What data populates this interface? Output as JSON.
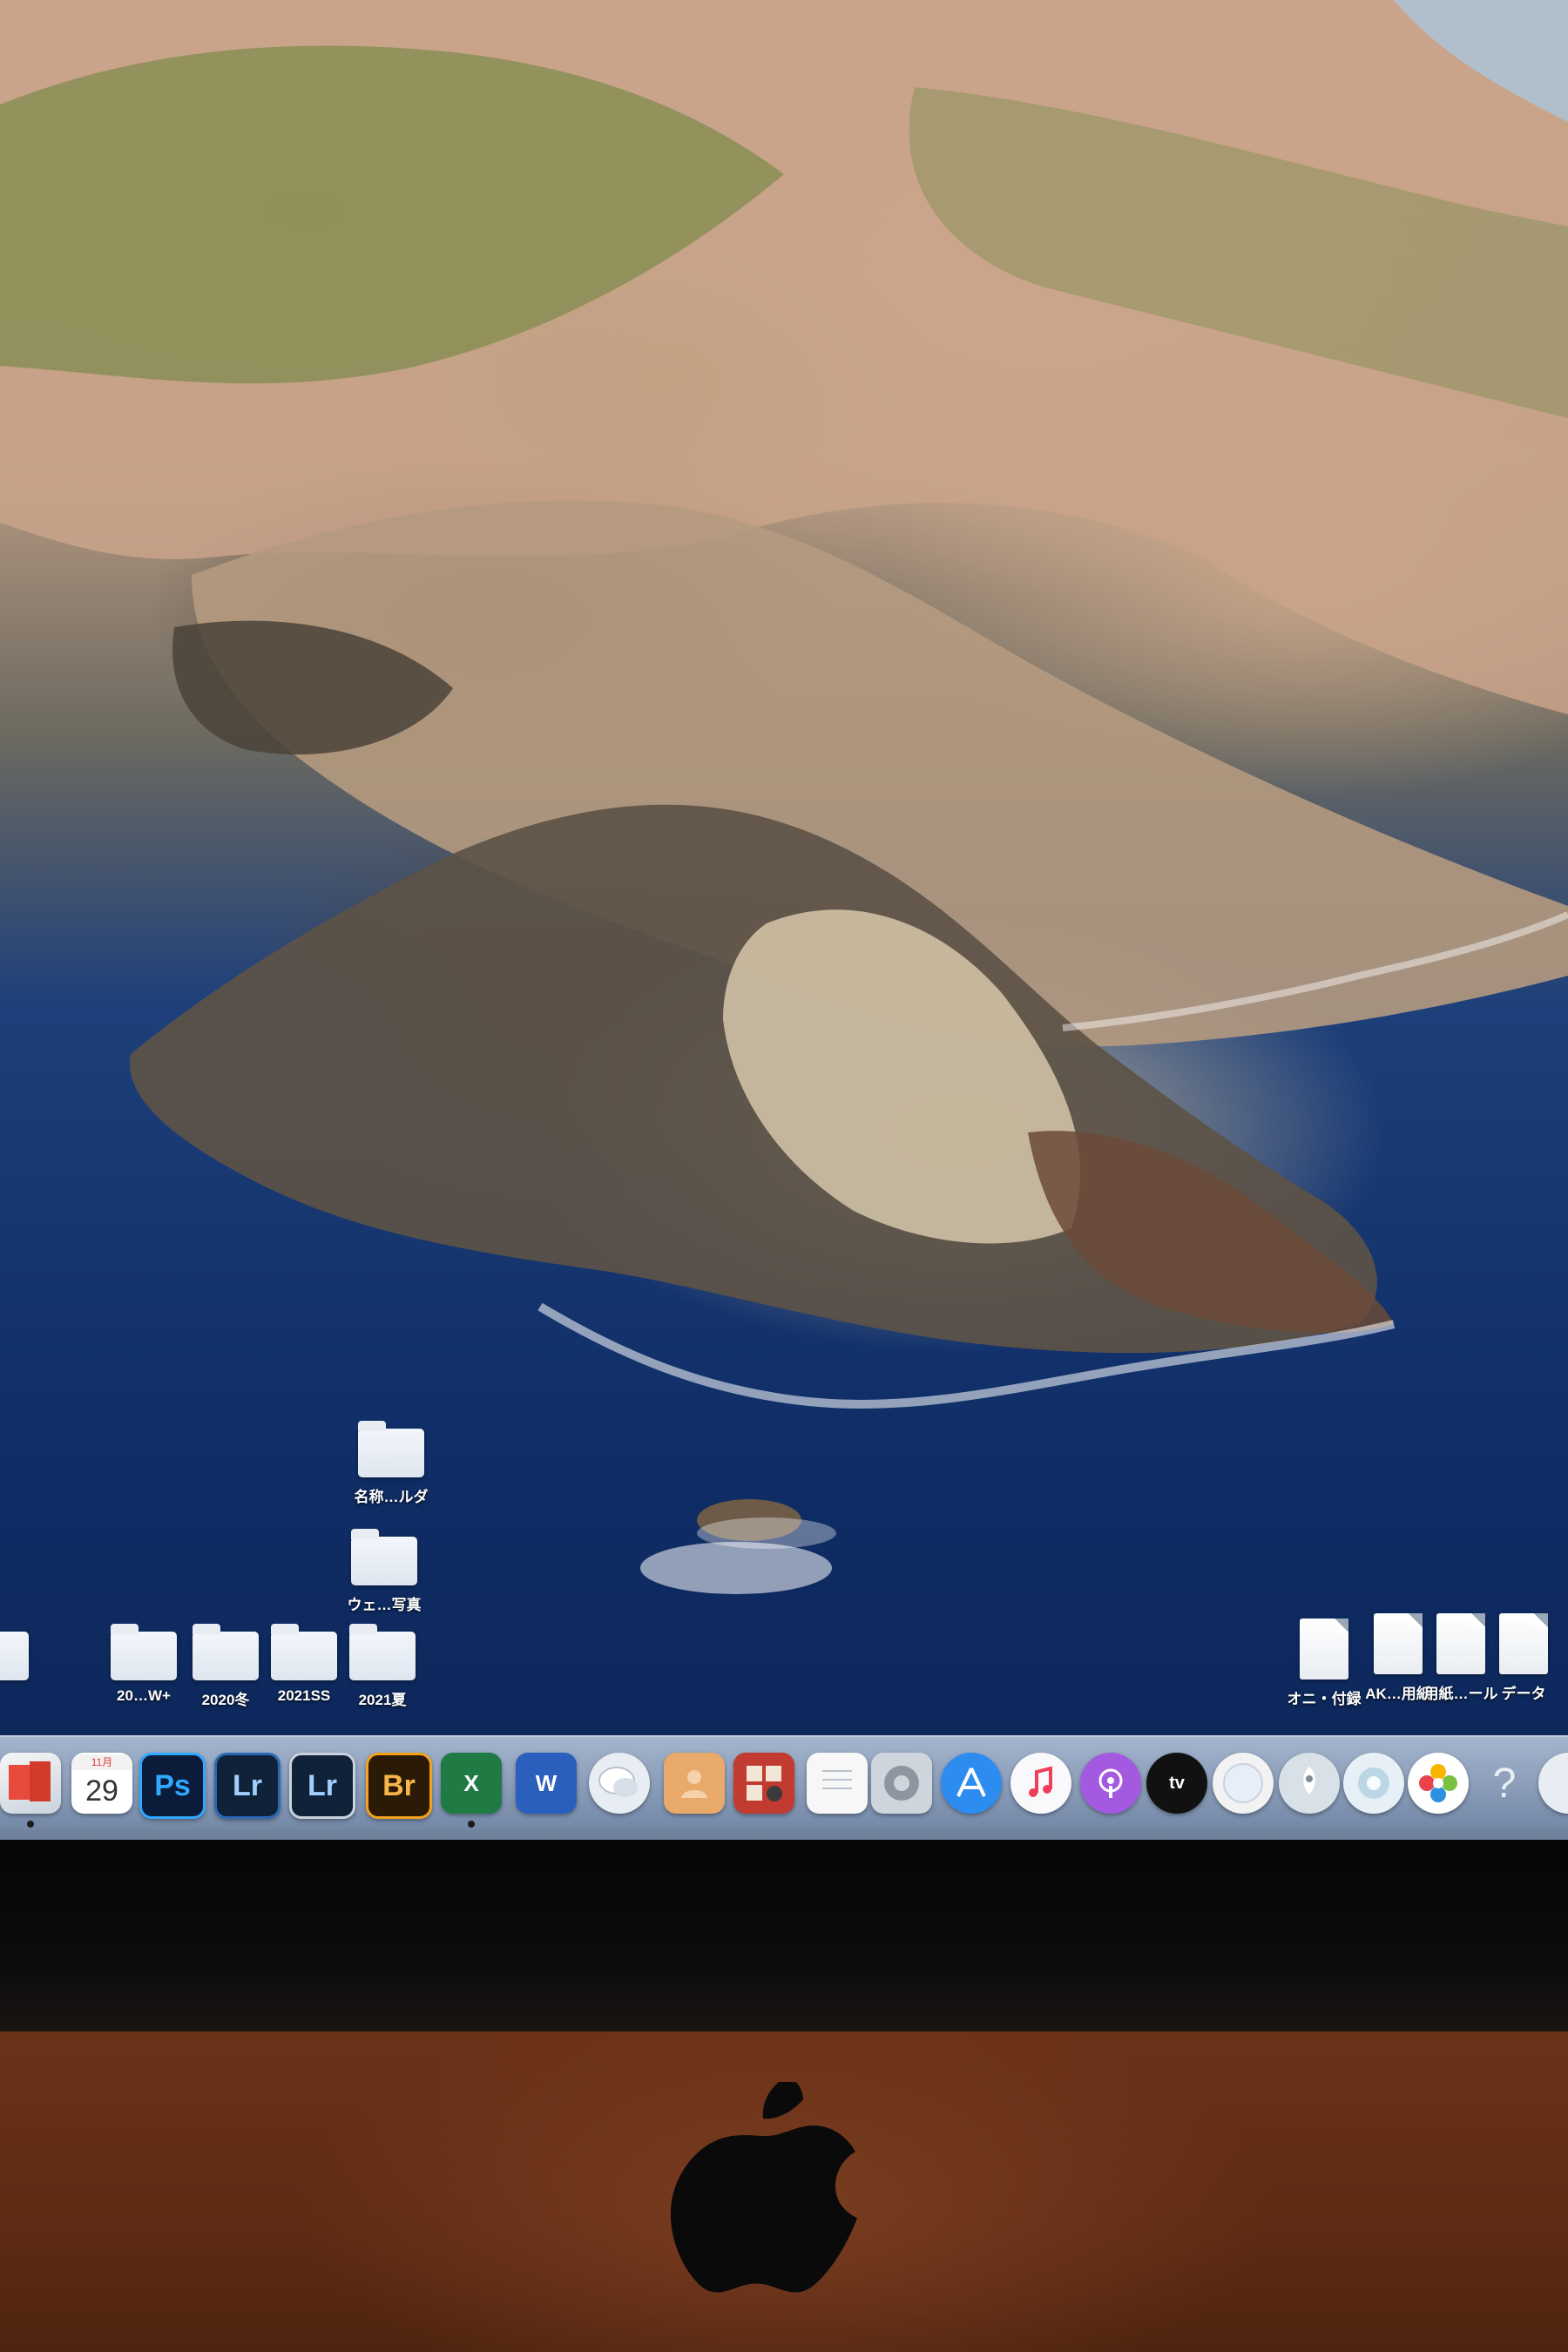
{
  "desktop": {
    "folders": [
      {
        "label": "名称…ルダ"
      },
      {
        "label": "ウェ…写真"
      },
      {
        "label": "20…W+"
      },
      {
        "label": "2020冬"
      },
      {
        "label": "2021SS"
      },
      {
        "label": "2021夏"
      }
    ],
    "files": [
      {
        "label": "オニ・付録"
      },
      {
        "label": "AK…用紙"
      },
      {
        "label": "用紙…ール"
      },
      {
        "label": "データ"
      }
    ]
  },
  "dock": {
    "items": [
      {
        "name": "preview",
        "label": ""
      },
      {
        "name": "calendar",
        "label": "29",
        "month": "11月"
      },
      {
        "name": "photoshop",
        "label": "Ps"
      },
      {
        "name": "lightroom",
        "label": "Lr"
      },
      {
        "name": "lightroom-classic",
        "label": "Lr"
      },
      {
        "name": "bridge",
        "label": "Br"
      },
      {
        "name": "excel",
        "label": "X"
      },
      {
        "name": "word",
        "label": "W"
      },
      {
        "name": "messages",
        "label": ""
      },
      {
        "name": "contacts",
        "label": ""
      },
      {
        "name": "photo-booth",
        "label": ""
      },
      {
        "name": "textedit",
        "label": ""
      },
      {
        "name": "system-preferences",
        "label": ""
      },
      {
        "name": "app-store",
        "label": ""
      },
      {
        "name": "music",
        "label": ""
      },
      {
        "name": "podcasts",
        "label": ""
      },
      {
        "name": "apple-tv",
        "label": "tv"
      },
      {
        "name": "safari",
        "label": ""
      },
      {
        "name": "launchpad",
        "label": ""
      },
      {
        "name": "finder-migration",
        "label": ""
      },
      {
        "name": "photos",
        "label": ""
      },
      {
        "name": "help",
        "label": "?"
      }
    ]
  },
  "colors": {
    "ps": "#0a1c3a",
    "lr": "#0f2238",
    "br": "#2b1a05",
    "excel": "#1f7a44",
    "word": "#2b5fbd",
    "ocean": "#0f2d66",
    "chin": "#5e2b14"
  }
}
